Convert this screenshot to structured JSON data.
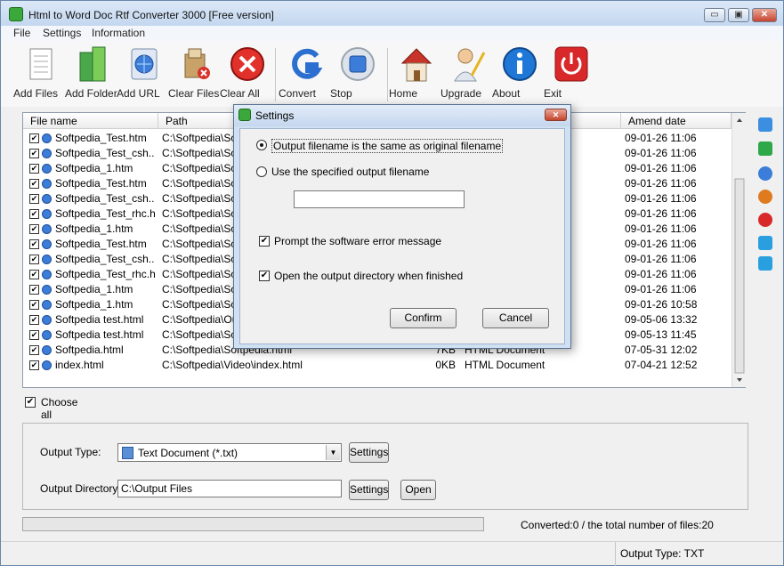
{
  "window": {
    "title": "Html to Word Doc Rtf Converter 3000 [Free version]",
    "minimize": "▭",
    "restore": "▣",
    "close": "✕"
  },
  "menu": [
    "File",
    "Settings",
    "Information"
  ],
  "toolbar": [
    {
      "label": "Add Files",
      "icon": "add-files-icon"
    },
    {
      "label": "Add Folder",
      "icon": "add-folder-icon"
    },
    {
      "label": "Add URL",
      "icon": "add-url-icon"
    },
    {
      "label": "Clear Files",
      "icon": "clear-files-icon"
    },
    {
      "label": "Clear All",
      "icon": "clear-all-icon"
    },
    {
      "label": "Convert",
      "icon": "convert-icon"
    },
    {
      "label": "Stop",
      "icon": "stop-icon"
    },
    {
      "label": "Home",
      "icon": "home-icon"
    },
    {
      "label": "Upgrade",
      "icon": "upgrade-icon"
    },
    {
      "label": "About",
      "icon": "about-icon"
    },
    {
      "label": "Exit",
      "icon": "exit-icon"
    }
  ],
  "file_list": {
    "columns": [
      "File name",
      "Path",
      "",
      "",
      "Amend date"
    ],
    "rows": [
      {
        "name": "Softpedia_Test.htm",
        "path": "C:\\Softpedia\\So",
        "size": "",
        "type": "",
        "date": "09-01-26 11:06",
        "checked": true
      },
      {
        "name": "Softpedia_Test_csh....",
        "path": "C:\\Softpedia\\So",
        "size": "",
        "type": "",
        "date": "09-01-26 11:06",
        "checked": true
      },
      {
        "name": "Softpedia_1.htm",
        "path": "C:\\Softpedia\\So",
        "size": "",
        "type": "",
        "date": "09-01-26 11:06",
        "checked": true
      },
      {
        "name": "Softpedia_Test.htm",
        "path": "C:\\Softpedia\\So",
        "size": "",
        "type": "",
        "date": "09-01-26 11:06",
        "checked": true
      },
      {
        "name": "Softpedia_Test_csh....",
        "path": "C:\\Softpedia\\So",
        "size": "",
        "type": "",
        "date": "09-01-26 11:06",
        "checked": true
      },
      {
        "name": "Softpedia_Test_rhc.h...",
        "path": "C:\\Softpedia\\So",
        "size": "",
        "type": "",
        "date": "09-01-26 11:06",
        "checked": true
      },
      {
        "name": "Softpedia_1.htm",
        "path": "C:\\Softpedia\\So",
        "size": "",
        "type": "",
        "date": "09-01-26 11:06",
        "checked": true
      },
      {
        "name": "Softpedia_Test.htm",
        "path": "C:\\Softpedia\\So",
        "size": "",
        "type": "",
        "date": "09-01-26 11:06",
        "checked": true
      },
      {
        "name": "Softpedia_Test_csh....",
        "path": "C:\\Softpedia\\So",
        "size": "",
        "type": "",
        "date": "09-01-26 11:06",
        "checked": true
      },
      {
        "name": "Softpedia_Test_rhc.h...",
        "path": "C:\\Softpedia\\So",
        "size": "",
        "type": "",
        "date": "09-01-26 11:06",
        "checked": true
      },
      {
        "name": "Softpedia_1.htm",
        "path": "C:\\Softpedia\\So",
        "size": "",
        "type": "",
        "date": "09-01-26 11:06",
        "checked": true
      },
      {
        "name": "Softpedia_1.htm",
        "path": "C:\\Softpedia\\So",
        "size": "",
        "type": "",
        "date": "09-01-26 10:58",
        "checked": true
      },
      {
        "name": "Softpedia test.html",
        "path": "C:\\Softpedia\\Ou",
        "size": "",
        "type": "",
        "date": "09-05-06 13:32",
        "checked": true
      },
      {
        "name": "Softpedia test.html",
        "path": "C:\\Softpedia\\So",
        "size": "",
        "type": "",
        "date": "09-05-13 11:45",
        "checked": true
      },
      {
        "name": "Softpedia.html",
        "path": "C:\\Softpedia\\Softpedia.html",
        "size": "7KB",
        "type": "HTML Document",
        "date": "07-05-31 12:02",
        "checked": true
      },
      {
        "name": "index.html",
        "path": "C:\\Softpedia\\Video\\index.html",
        "size": "0KB",
        "type": "HTML Document",
        "date": "07-04-21 12:52",
        "checked": true
      }
    ]
  },
  "choose_all": {
    "label": "Choose all",
    "checked": true
  },
  "output": {
    "type_label": "Output Type:",
    "type_value": "Text Document (*.txt)",
    "dir_label": "Output Directory:",
    "dir_value": "C:\\Output Files",
    "settings_btn": "Settings",
    "open_btn": "Open"
  },
  "progress": {
    "value": 0
  },
  "conversion_status": "Converted:0  /  the total number of files:20",
  "statusbar": {
    "left": "",
    "right": "Output Type: TXT"
  },
  "dialog": {
    "title": "Settings",
    "close": "✕",
    "radio_same": "Output filename is the same as original filename",
    "radio_specified": "Use the specified output filename",
    "output_filename": "",
    "chk_prompt": "Prompt the software error message",
    "chk_open_dir": "Open the output directory when finished",
    "confirm": "Confirm",
    "cancel": "Cancel"
  },
  "colors": {
    "accent": "#3b7dd8",
    "close_red": "#c7442e",
    "dialog_frame": "#cfe0f3"
  }
}
